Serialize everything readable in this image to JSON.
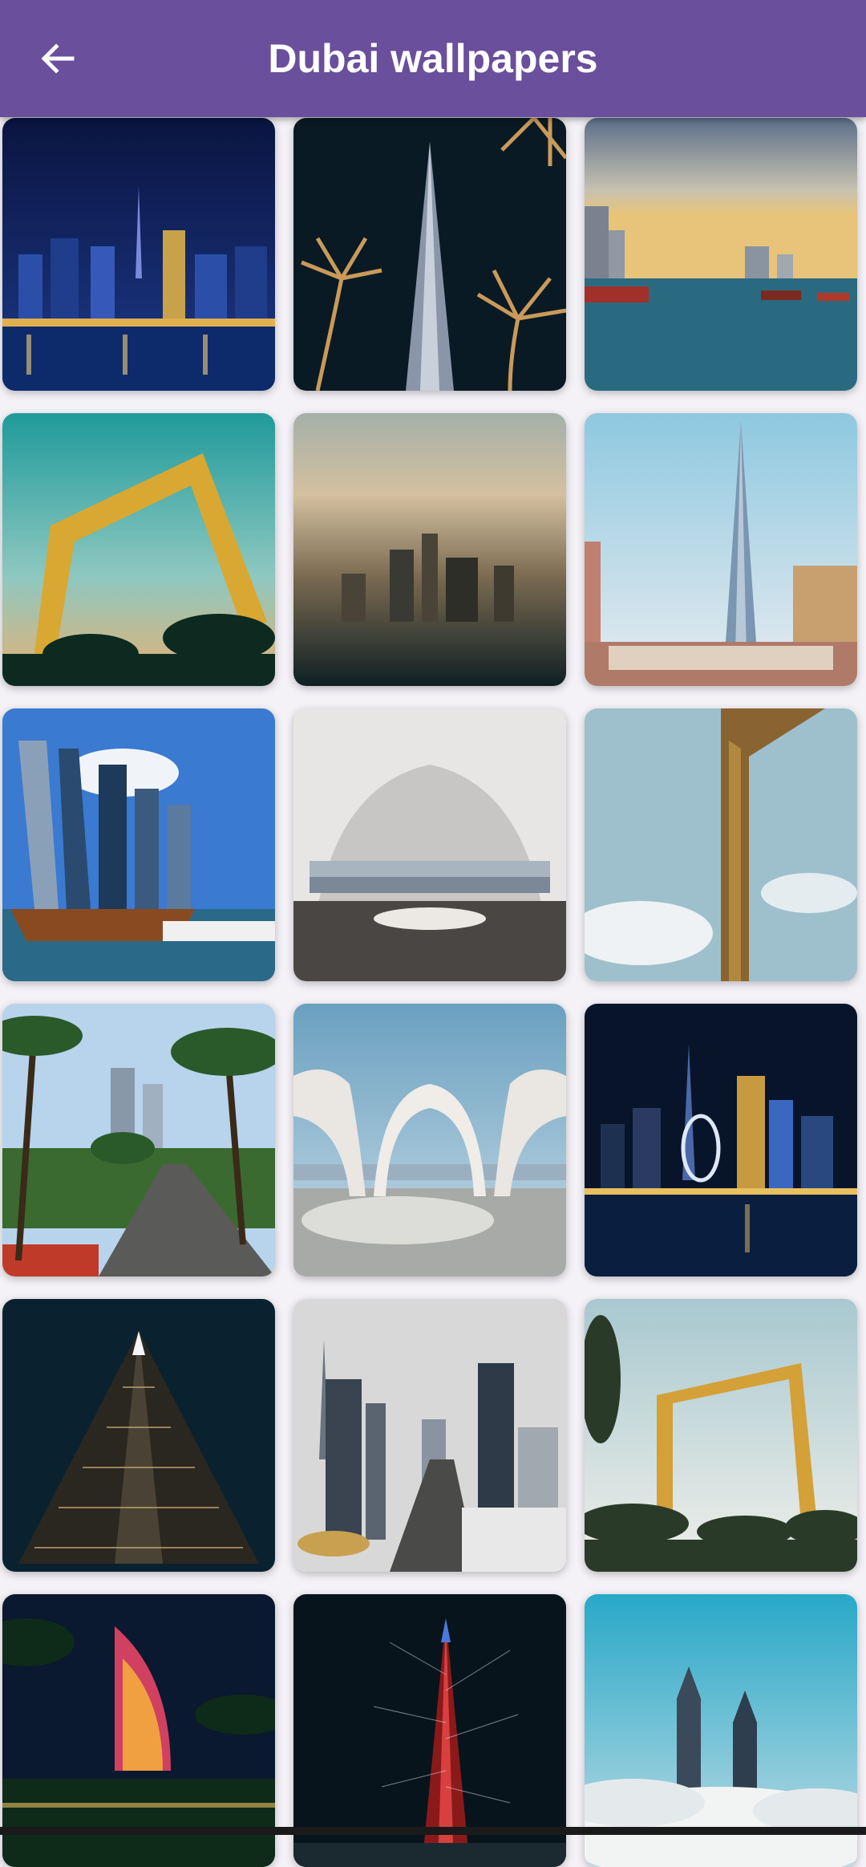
{
  "app_bar": {
    "title": "Dubai wallpapers",
    "back_icon": "arrow-back-icon",
    "background": "#6a4f9c"
  },
  "wallpapers": [
    {
      "subject": "skyline-night"
    },
    {
      "subject": "burj-khalifa-palms"
    },
    {
      "subject": "creek-boats-sunset"
    },
    {
      "subject": "dubai-frame-teal"
    },
    {
      "subject": "aerial-haze"
    },
    {
      "subject": "burj-khalifa-dubai-letters"
    },
    {
      "subject": "marina-dhow"
    },
    {
      "subject": "arch-terrace"
    },
    {
      "subject": "dubai-frame-clouds"
    },
    {
      "subject": "palm-avenue"
    },
    {
      "subject": "white-arches"
    },
    {
      "subject": "night-waterfront-ring"
    },
    {
      "subject": "burj-khalifa-night"
    },
    {
      "subject": "sheikh-zayed-road"
    },
    {
      "subject": "dubai-frame-palms"
    },
    {
      "subject": "burj-al-arab-night"
    },
    {
      "subject": "burj-khalifa-lights"
    },
    {
      "subject": "emirates-towers-fog"
    }
  ]
}
